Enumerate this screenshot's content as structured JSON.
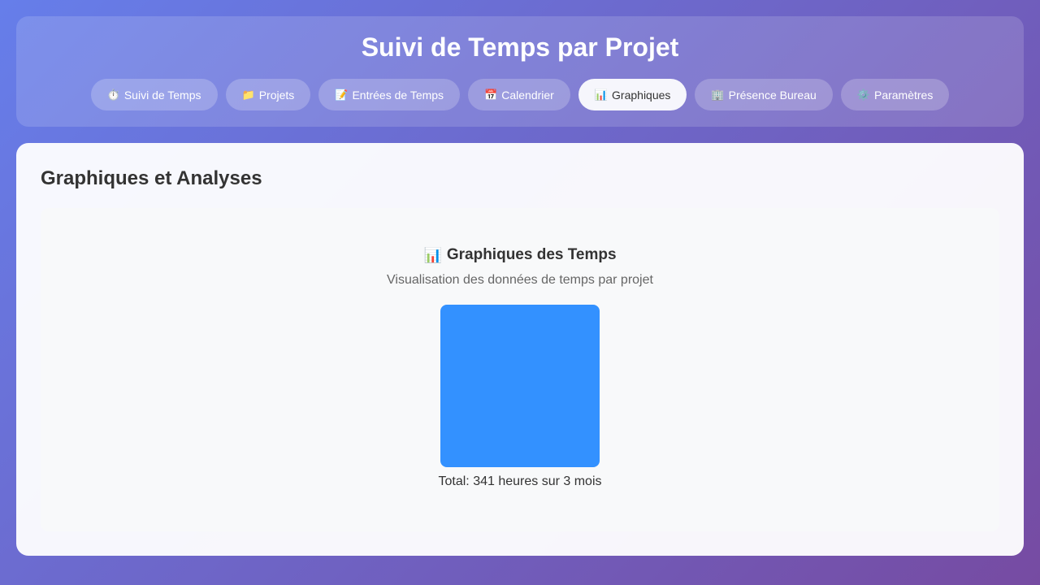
{
  "header": {
    "title": "Suivi de Temps par Projet"
  },
  "nav": {
    "tabs": [
      {
        "icon": "⏱️",
        "label": "Suivi de Temps",
        "active": false
      },
      {
        "icon": "📁",
        "label": "Projets",
        "active": false
      },
      {
        "icon": "📝",
        "label": "Entrées de Temps",
        "active": false
      },
      {
        "icon": "📅",
        "label": "Calendrier",
        "active": false
      },
      {
        "icon": "📊",
        "label": "Graphiques",
        "active": true
      },
      {
        "icon": "🏢",
        "label": "Présence Bureau",
        "active": false
      },
      {
        "icon": "⚙️",
        "label": "Paramètres",
        "active": false
      }
    ]
  },
  "main": {
    "section_title": "Graphiques et Analyses",
    "chart_panel": {
      "icon": "📊",
      "heading": "Graphiques des Temps",
      "subtitle": "Visualisation des données de temps par projet",
      "total_text": "Total: 341 heures sur 3 mois"
    }
  },
  "colors": {
    "accent": "#3391ff",
    "active_tab_bg": "#f5f6fb",
    "gradient_start": "#667eea",
    "gradient_end": "#764ba2"
  },
  "chart_data": {
    "type": "bar",
    "categories": [
      ""
    ],
    "values": [
      341
    ],
    "title": "Graphiques des Temps",
    "xlabel": "",
    "ylabel": "",
    "color": "#3391ff"
  }
}
